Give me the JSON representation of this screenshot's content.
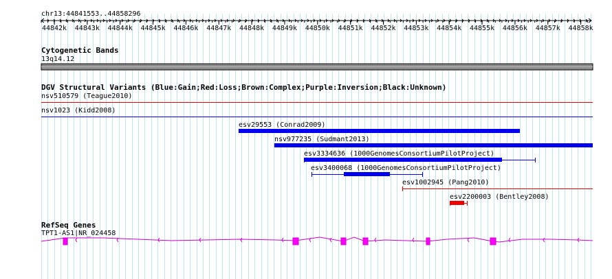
{
  "ruler": {
    "range_label": "chr13:44841553..44858296",
    "ticks": [
      "44842k",
      "44843k",
      "44844k",
      "44845k",
      "44846k",
      "44847k",
      "44848k",
      "44849k",
      "44850k",
      "44851k",
      "44852k",
      "44853k",
      "44854k",
      "44855k",
      "44856k",
      "44857k",
      "44858k"
    ]
  },
  "cytobands": {
    "title": "Cytogenetic Bands",
    "band_label": "13q14.12",
    "band_color": "#8c8c8c"
  },
  "dgv": {
    "title": "DGV Structural Variants (Blue:Gain;Red:Loss;Brown:Complex;Purple:Inversion;Black:Unknown)",
    "colors": {
      "gain": "#0000ee",
      "loss": "#ee0000"
    },
    "features": [
      {
        "label": "nsv510579 (Teague2010)",
        "type": "loss"
      },
      {
        "label": "nsv1023 (Kidd2008)",
        "type": "gain"
      },
      {
        "label": "esv29553 (Conrad2009)",
        "type": "gain"
      },
      {
        "label": "nsv977235 (Sudmant2013)",
        "type": "gain"
      },
      {
        "label": "esv3334636 (1000GenomesConsortiumPilotProject)",
        "type": "gain"
      },
      {
        "label": "esv3400068 (1000GenomesConsortiumPilotProject)",
        "type": "gain"
      },
      {
        "label": "esv1002945 (Pang2010)",
        "type": "loss"
      },
      {
        "label": "esv2200003 (Bentley2008)",
        "type": "loss"
      }
    ]
  },
  "refseq": {
    "title": "RefSeq Genes",
    "gene_label": "TPT1-AS1|NR_024458",
    "gene_color": "#cc00cc"
  }
}
